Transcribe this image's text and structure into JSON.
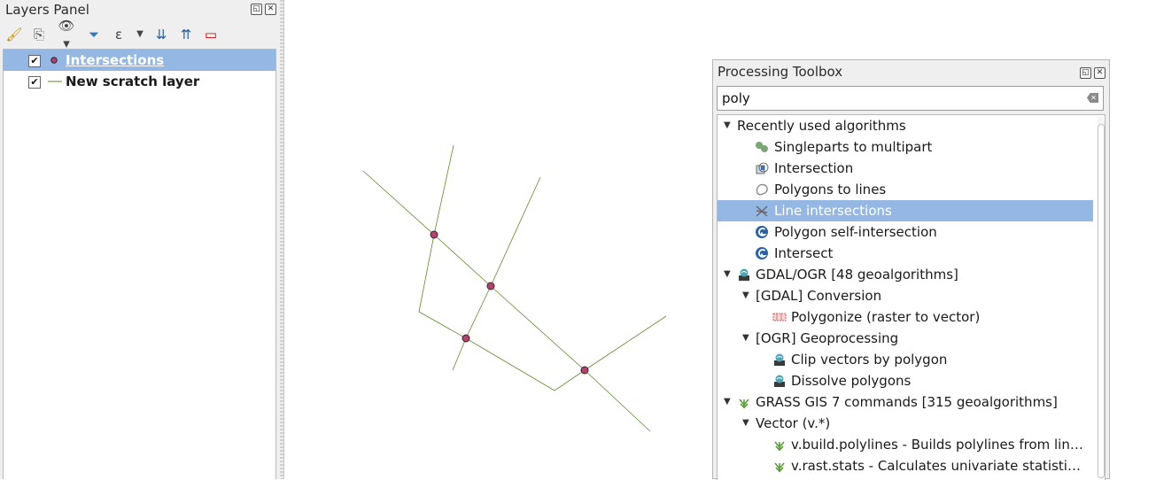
{
  "layers_panel": {
    "title": "Layers Panel",
    "toolbar_icons": [
      "style-brush-icon",
      "add-group-icon",
      "eye-visibility-icon",
      "filter-icon",
      "expression-filter-icon",
      "dropdown-arrow-icon",
      "expand-all-icon",
      "collapse-all-icon",
      "remove-layer-icon"
    ],
    "layers": [
      {
        "name": "Intersections",
        "checked": true,
        "symbol": "point",
        "selected": true
      },
      {
        "name": "New scratch layer",
        "checked": true,
        "symbol": "line",
        "selected": false
      }
    ]
  },
  "toolbox": {
    "title": "Processing Toolbox",
    "search_value": "poly",
    "tree": [
      {
        "label": "Recently used algorithms",
        "depth": 0,
        "expandable": true,
        "icon": "none"
      },
      {
        "label": "Singleparts to multipart",
        "depth": 1,
        "icon": "multipart-icon"
      },
      {
        "label": "Intersection",
        "depth": 1,
        "icon": "intersection-icon"
      },
      {
        "label": "Polygons to lines",
        "depth": 1,
        "icon": "polygon-to-lines-icon"
      },
      {
        "label": "Line intersections",
        "depth": 1,
        "icon": "line-intersections-icon",
        "selected": true
      },
      {
        "label": "Polygon self-intersection",
        "depth": 1,
        "icon": "saga-icon"
      },
      {
        "label": "Intersect",
        "depth": 1,
        "icon": "saga-icon"
      },
      {
        "label": "GDAL/OGR [48 geoalgorithms]",
        "depth": 0,
        "expandable": true,
        "icon": "gdal-icon"
      },
      {
        "label": "[GDAL] Conversion",
        "depth": 1,
        "expandable": true,
        "icon": "none"
      },
      {
        "label": "Polygonize (raster to vector)",
        "depth": 2,
        "icon": "polygonize-icon"
      },
      {
        "label": "[OGR] Geoprocessing",
        "depth": 1,
        "expandable": true,
        "icon": "none"
      },
      {
        "label": "Clip vectors by polygon",
        "depth": 2,
        "icon": "gdal-icon"
      },
      {
        "label": "Dissolve polygons",
        "depth": 2,
        "icon": "gdal-icon"
      },
      {
        "label": "GRASS GIS 7 commands [315 geoalgorithms]",
        "depth": 0,
        "expandable": true,
        "icon": "grass-icon"
      },
      {
        "label": "Vector (v.*)",
        "depth": 1,
        "expandable": true,
        "icon": "none"
      },
      {
        "label": "v.build.polylines - Builds polylines from line...",
        "depth": 2,
        "icon": "grass-icon"
      },
      {
        "label": "v.rast.stats - Calculates univariate statistics ...",
        "depth": 2,
        "icon": "grass-icon"
      }
    ]
  },
  "colors": {
    "selection": "#94b8e3",
    "line": "#5c8a2e",
    "point_fill": "#b0436b",
    "point_stroke": "#3a2030"
  }
}
